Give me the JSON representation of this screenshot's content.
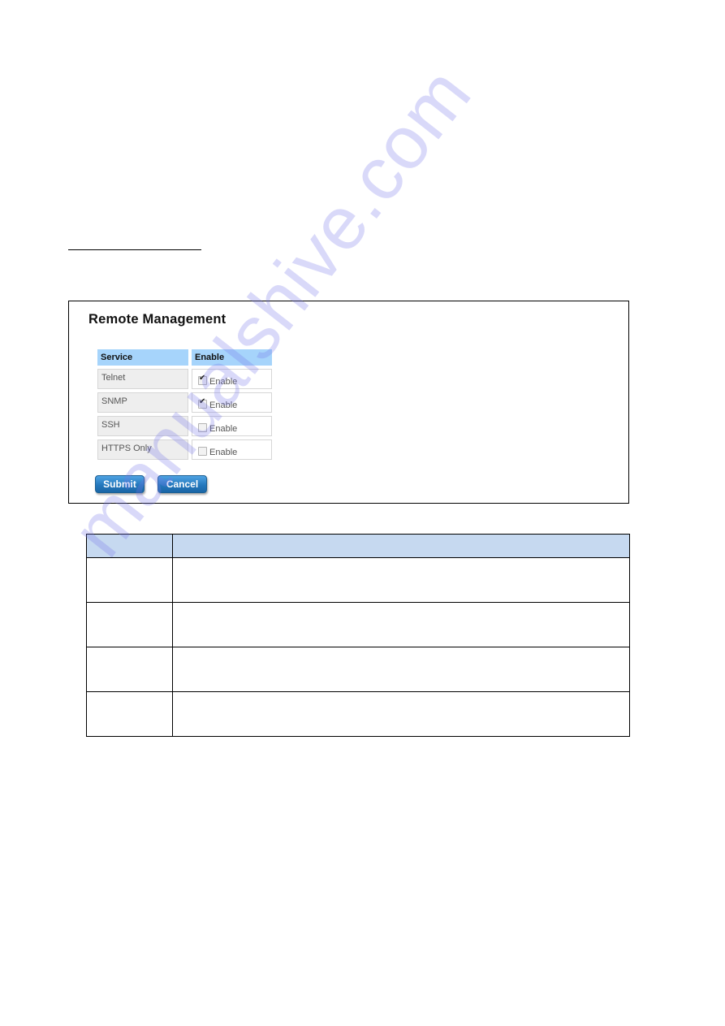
{
  "panel": {
    "title": "Remote Management",
    "table": {
      "headers": [
        "Service",
        "Enable"
      ],
      "rows": [
        {
          "service": "Telnet",
          "enable_label": "Enable",
          "checked": true
        },
        {
          "service": "SNMP",
          "enable_label": "Enable",
          "checked": true
        },
        {
          "service": "SSH",
          "enable_label": "Enable",
          "checked": false
        },
        {
          "service": "HTTPS Only",
          "enable_label": "Enable",
          "checked": false
        }
      ]
    },
    "buttons": {
      "submit": "Submit",
      "cancel": "Cancel"
    }
  },
  "description_table": {
    "headers": [
      "",
      ""
    ],
    "rows": [
      [
        "",
        ""
      ],
      [
        "",
        ""
      ],
      [
        "",
        ""
      ],
      [
        "",
        ""
      ]
    ]
  },
  "colors": {
    "header_blue": "#a6d4fb",
    "button_blue": "#2478bd",
    "desc_header": "#c6d9f0"
  },
  "watermark": "manualshive.com"
}
